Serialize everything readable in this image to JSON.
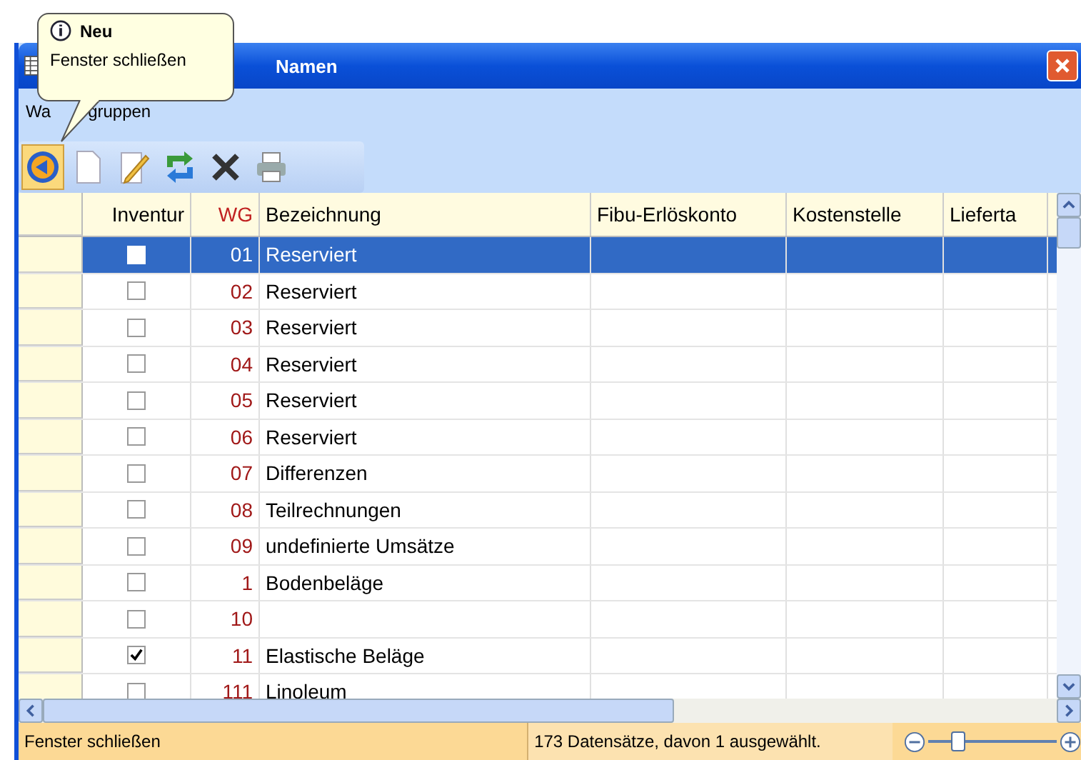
{
  "window": {
    "title": "Namen"
  },
  "tooltip": {
    "title": "Neu",
    "text": "Fenster schließen"
  },
  "menu": [
    {
      "start": "Wa",
      "end": "gruppen"
    }
  ],
  "toolbar": [
    {
      "kind": "back"
    },
    {
      "kind": "new"
    },
    {
      "kind": "edit"
    },
    {
      "kind": "refresh"
    },
    {
      "kind": "delete"
    },
    {
      "kind": "print"
    }
  ],
  "table": {
    "columns": [
      "Inventur",
      "WG",
      "Bezeichnung",
      "Fibu-Erlöskonto",
      "Kostenstelle",
      "Lieferta"
    ],
    "rows": [
      {
        "checked": false,
        "wg": "01",
        "name": "Reserviert",
        "selected": true
      },
      {
        "checked": false,
        "wg": "02",
        "name": "Reserviert",
        "selected": false
      },
      {
        "checked": false,
        "wg": "03",
        "name": "Reserviert",
        "selected": false
      },
      {
        "checked": false,
        "wg": "04",
        "name": "Reserviert",
        "selected": false
      },
      {
        "checked": false,
        "wg": "05",
        "name": "Reserviert",
        "selected": false
      },
      {
        "checked": false,
        "wg": "06",
        "name": "Reserviert",
        "selected": false
      },
      {
        "checked": false,
        "wg": "07",
        "name": "Differenzen",
        "selected": false
      },
      {
        "checked": false,
        "wg": "08",
        "name": "Teilrechnungen",
        "selected": false
      },
      {
        "checked": false,
        "wg": "09",
        "name": "undefinierte Umsätze",
        "selected": false
      },
      {
        "checked": false,
        "wg": "1",
        "name": "Bodenbeläge",
        "selected": false
      },
      {
        "checked": false,
        "wg": "10",
        "selected": false
      },
      {
        "checked": true,
        "wg": "11",
        "name": "Elastische Beläge",
        "selected": false
      },
      {
        "checked": false,
        "wg": "111",
        "name": "Linoleum",
        "selected": false
      }
    ]
  },
  "status_bar": {
    "hint": "Fenster schließen",
    "records": "173 Datensätze, davon 1 ausgewählt.",
    "zoom": {
      "level": 0.22
    }
  }
}
